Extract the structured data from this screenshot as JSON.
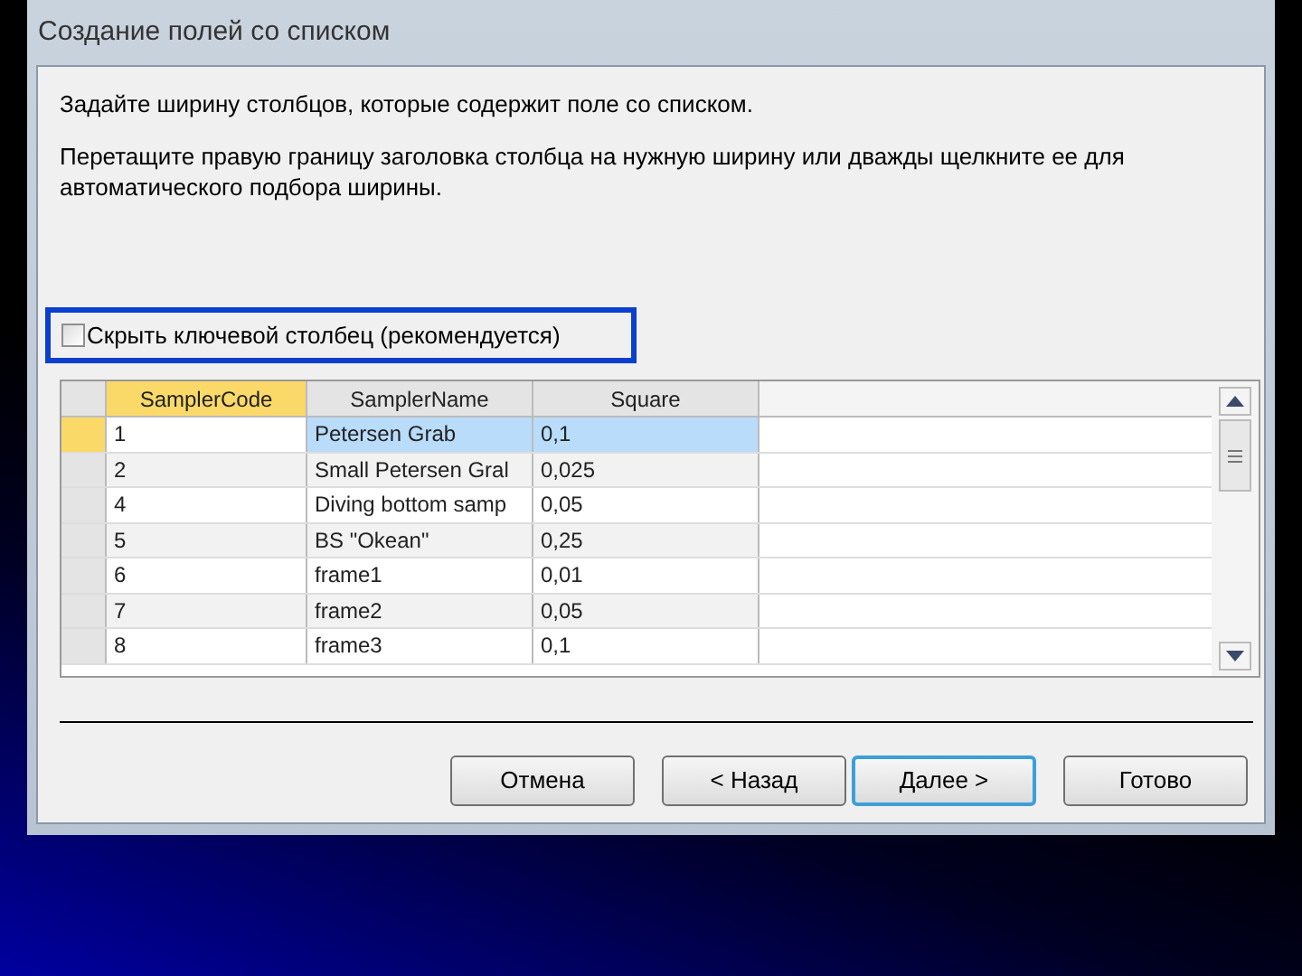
{
  "window": {
    "title": "Создание полей со списком"
  },
  "instructions": [
    "Задайте ширину столбцов, которые содержит поле со списком.",
    "Перетащите правую границу заголовка столбца на нужную ширину или дважды щелкните ее для автоматического подбора ширины."
  ],
  "checkbox": {
    "label": "Скрыть ключевой столбец (рекомендуется)",
    "checked": false,
    "highlighted": true
  },
  "table": {
    "columns": [
      {
        "label": "SamplerCode",
        "selected": true
      },
      {
        "label": "SamplerName",
        "selected": false
      },
      {
        "label": "Square",
        "selected": false
      }
    ],
    "rows": [
      {
        "cells": [
          "1",
          "Petersen Grab",
          "0,1"
        ],
        "selected": true
      },
      {
        "cells": [
          "2",
          "Small Petersen Gral",
          "0,025"
        ],
        "selected": false
      },
      {
        "cells": [
          "4",
          "Diving bottom samp",
          "0,05"
        ],
        "selected": false
      },
      {
        "cells": [
          "5",
          "BS \"Okean\"",
          "0,25"
        ],
        "selected": false
      },
      {
        "cells": [
          "6",
          "frame1",
          "0,01"
        ],
        "selected": false
      },
      {
        "cells": [
          "7",
          "frame2",
          "0,05"
        ],
        "selected": false
      },
      {
        "cells": [
          "8",
          "frame3",
          "0,1"
        ],
        "selected": false
      }
    ]
  },
  "buttons": [
    {
      "label": "Отмена",
      "default": false
    },
    {
      "label": "< Назад",
      "default": false
    },
    {
      "label": "Далее >",
      "default": true
    },
    {
      "label": "Готово",
      "default": false
    }
  ]
}
